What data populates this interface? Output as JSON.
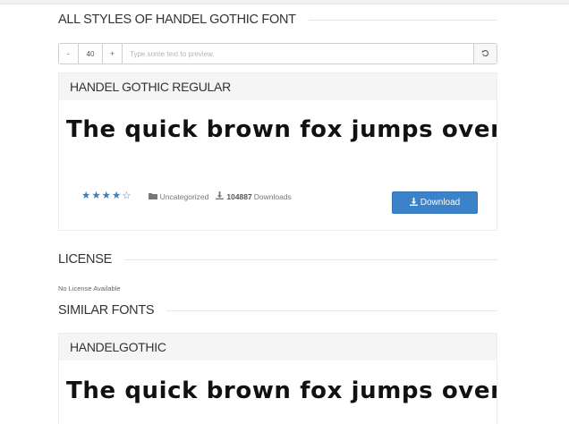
{
  "page": {
    "heading": "ALL STYLES OF HANDEL GOTHIC FONT"
  },
  "controls": {
    "decrease_label": "-",
    "size_value": "40",
    "increase_label": "+",
    "preview_placeholder": "Type some text to preview.",
    "reset_icon": "undo-icon"
  },
  "font_card": {
    "title": "HANDEL GOTHIC REGULAR",
    "preview_text": "The quick brown fox jumps over the lazy dog",
    "rating": 4.5,
    "rating_max": 5,
    "category": "Uncategorized",
    "downloads_count": "104887",
    "downloads_label": "Downloads",
    "download_button": "Download",
    "accent_color": "#3c82c9"
  },
  "license": {
    "heading": "LICENSE",
    "text": "No License Available"
  },
  "similar": {
    "heading": "SIMILAR FONTS",
    "cards": [
      {
        "title": "HANDELGOTHIC",
        "preview_text": "The quick brown fox jumps over the lazy dog"
      }
    ]
  }
}
